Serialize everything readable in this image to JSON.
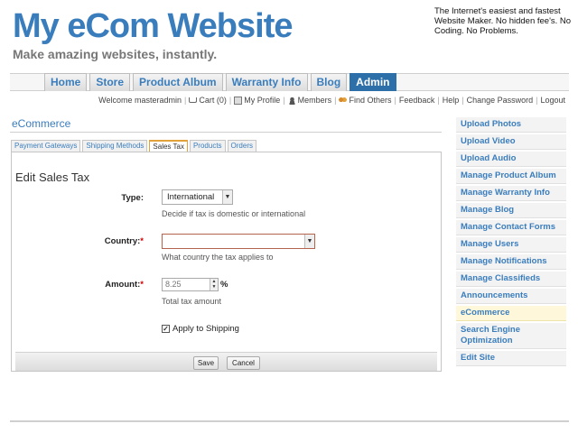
{
  "header": {
    "site_title": "My eCom Website",
    "tagline": "Make amazing websites, instantly.",
    "promo": "The Internet's easiest and fastest Website Maker. No hidden fee's. No Coding. No Problems."
  },
  "topnav": {
    "tabs": [
      {
        "label": "Home"
      },
      {
        "label": "Store"
      },
      {
        "label": "Product Album"
      },
      {
        "label": "Warranty Info"
      },
      {
        "label": "Blog"
      },
      {
        "label": "Admin",
        "active": true
      }
    ]
  },
  "userbar": {
    "welcome": "Welcome masteradmin",
    "cart": "Cart (0)",
    "profile": "My Profile",
    "members": "Members",
    "find_others": "Find Others",
    "feedback": "Feedback",
    "help": "Help",
    "change_password": "Change Password",
    "logout": "Logout"
  },
  "section_title": "eCommerce",
  "subtabs": [
    {
      "label": "Payment Gateways"
    },
    {
      "label": "Shipping Methods"
    },
    {
      "label": "Sales Tax",
      "active": true
    },
    {
      "label": "Products"
    },
    {
      "label": "Orders"
    }
  ],
  "form": {
    "heading": "Edit Sales Tax",
    "type_label": "Type:",
    "type_value": "International",
    "type_help": "Decide if tax is domestic or international",
    "country_label": "Country:",
    "country_value": "",
    "country_help": "What country the tax applies to",
    "amount_label": "Amount:",
    "amount_placeholder": "8.25",
    "amount_unit": "%",
    "amount_help": "Total tax amount",
    "apply_shipping_label": "Apply to Shipping",
    "apply_shipping_checked": true,
    "required_mark": "*",
    "save_label": "Save",
    "cancel_label": "Cancel"
  },
  "sidebar": {
    "items": [
      {
        "label": "Upload Photos"
      },
      {
        "label": "Upload Video"
      },
      {
        "label": "Upload Audio"
      },
      {
        "label": "Manage Product Album"
      },
      {
        "label": "Manage Warranty Info"
      },
      {
        "label": "Manage Blog"
      },
      {
        "label": "Manage Contact Forms"
      },
      {
        "label": "Manage Users"
      },
      {
        "label": "Manage Notifications"
      },
      {
        "label": "Manage Classifieds"
      },
      {
        "label": "Announcements"
      },
      {
        "label": "eCommerce",
        "active": true
      },
      {
        "label": "Search Engine Optimization"
      },
      {
        "label": "Edit Site"
      }
    ]
  },
  "colors": {
    "brand": "#3a7dbd",
    "active_tab": "#2d6fa8",
    "required": "#cc0000",
    "active_sidebar": "#fff7d9"
  },
  "icons": {
    "cart": "cart-icon",
    "profile": "profile-icon",
    "members": "members-icon",
    "find_others": "find-others-icon"
  }
}
